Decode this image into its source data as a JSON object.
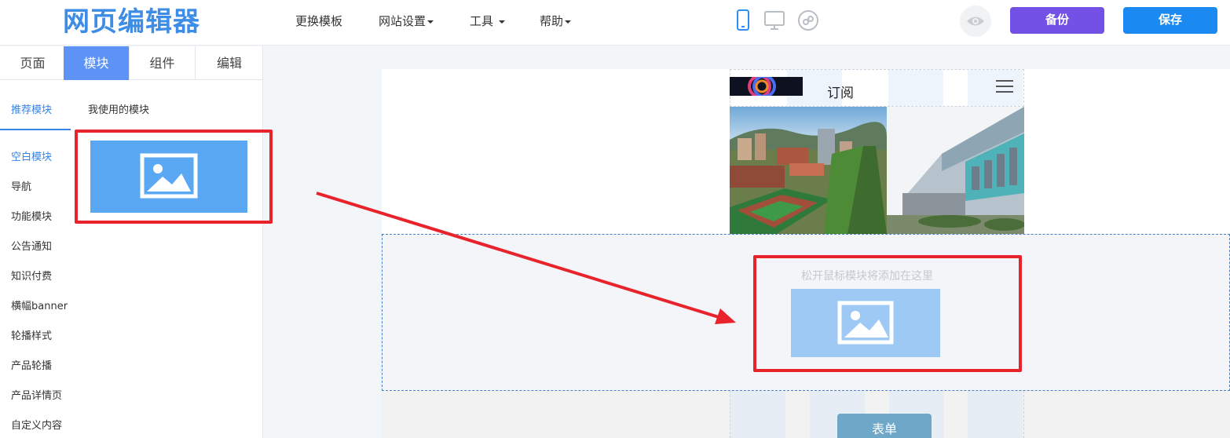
{
  "header": {
    "logo": "网页编辑器",
    "menu": [
      "更换模板",
      "网站设置",
      "工具",
      "帮助"
    ],
    "backup_label": "备份",
    "save_label": "保存"
  },
  "left_panel": {
    "tabs": [
      "页面",
      "模块",
      "组件",
      "编辑"
    ],
    "active_tab": "模块",
    "subtabs": [
      "推荐模块",
      "我使用的模块"
    ],
    "categories": [
      "空白模块",
      "导航",
      "功能模块",
      "公告通知",
      "知识付费",
      "横幅banner",
      "轮播样式",
      "产品轮播",
      "产品详情页",
      "自定义内容"
    ]
  },
  "canvas": {
    "subscribe_text": "订阅",
    "drop_hint": "松开鼠标模块将添加在这里",
    "form_button": "表单"
  },
  "colors": {
    "primary": "#1a8af2",
    "backup": "#7350e6",
    "active_tab": "#5c93f5",
    "highlight": "#e8232b"
  }
}
